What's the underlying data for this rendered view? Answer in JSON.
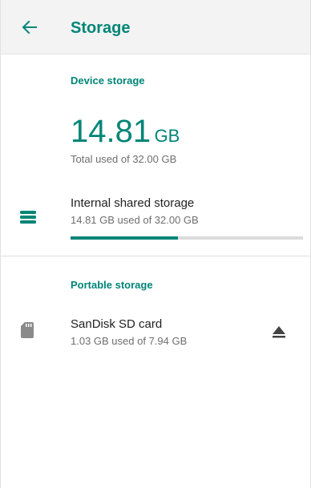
{
  "appbar": {
    "title": "Storage",
    "back_icon": "arrow-back-icon",
    "accent": "#008577"
  },
  "device_storage": {
    "header": "Device storage",
    "used_value": "14.81",
    "used_unit": "GB",
    "total_line": "Total used of 32.00 GB"
  },
  "internal": {
    "icon": "storage-list-icon",
    "title": "Internal shared storage",
    "subtitle": "14.81 GB used of 32.00 GB",
    "used_fraction": 0.463
  },
  "portable_storage": {
    "header": "Portable storage"
  },
  "sd_card": {
    "icon": "sd-card-icon",
    "title": "SanDisk SD card",
    "subtitle": "1.03 GB used of 7.94 GB",
    "action_icon": "eject-icon"
  }
}
